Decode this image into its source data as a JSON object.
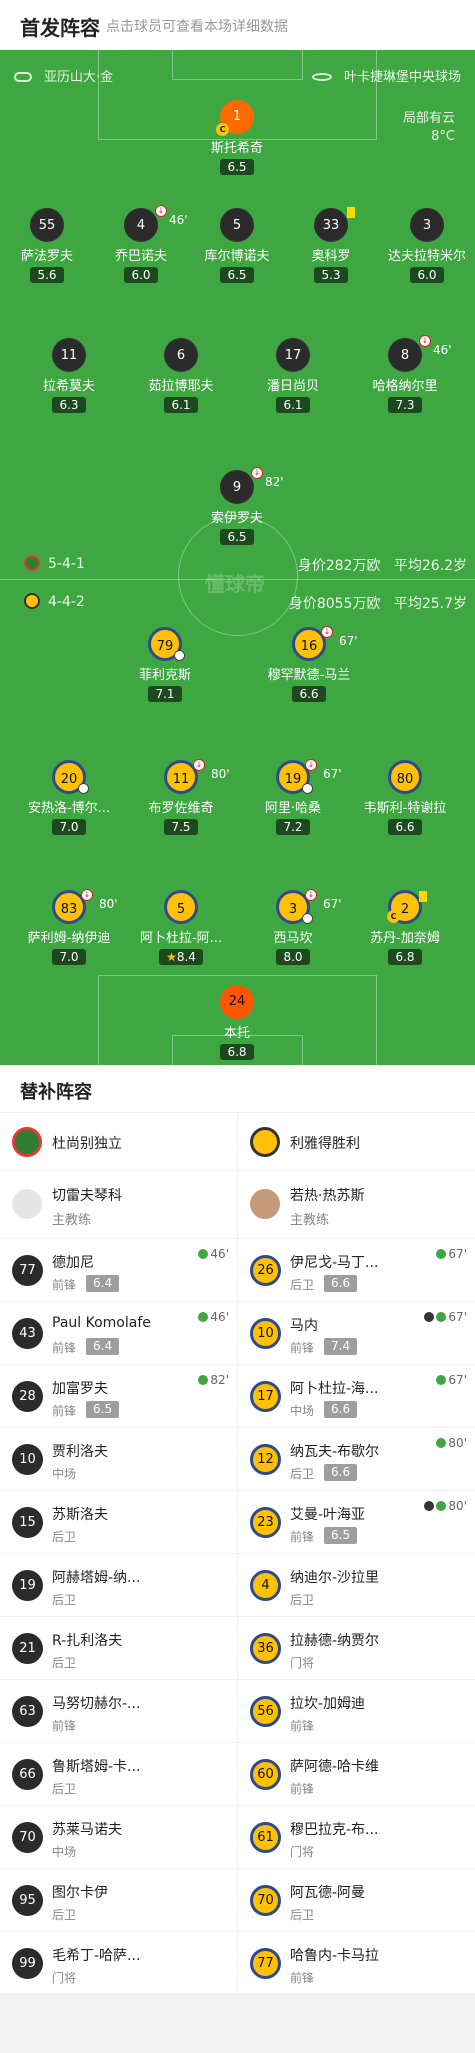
{
  "header": {
    "title": "首发阵容",
    "subtitle": "点击球员可查看本场详细数据"
  },
  "pitch": {
    "home_venue": "亚历山大·金",
    "away_venue": "叶卡捷琳堡中央球场",
    "weather": "局部有云",
    "temperature": "8°C",
    "home_formation": "5-4-1",
    "away_formation": "4-4-2",
    "home_value": "身价282万欧",
    "home_age": "平均26.2岁",
    "away_value": "身价8055万欧",
    "away_age": "平均25.7岁",
    "watermark": "懂球帝"
  },
  "home_lineup": [
    {
      "num": "1",
      "name": "斯托希奇",
      "rating": "6.5"
    },
    {
      "num": "55",
      "name": "萨法罗夫",
      "rating": "5.6"
    },
    {
      "num": "4",
      "name": "乔巴诺夫",
      "rating": "6.0",
      "sub": "46'"
    },
    {
      "num": "5",
      "name": "库尔博诺夫",
      "rating": "6.5"
    },
    {
      "num": "33",
      "name": "奥科罗",
      "rating": "5.3"
    },
    {
      "num": "3",
      "name": "达夫拉特米尔",
      "rating": "6.0"
    },
    {
      "num": "11",
      "name": "拉希莫夫",
      "rating": "6.3"
    },
    {
      "num": "6",
      "name": "茹拉博耶夫",
      "rating": "6.1"
    },
    {
      "num": "17",
      "name": "潘日尚贝",
      "rating": "6.1"
    },
    {
      "num": "8",
      "name": "哈格纳尔里",
      "rating": "7.3",
      "sub": "46'"
    },
    {
      "num": "9",
      "name": "索伊罗夫",
      "rating": "6.5",
      "sub": "82'"
    }
  ],
  "away_lineup": [
    {
      "num": "79",
      "name": "菲利克斯",
      "rating": "7.1"
    },
    {
      "num": "16",
      "name": "穆罕默德-马兰",
      "rating": "6.6",
      "sub": "67'"
    },
    {
      "num": "20",
      "name": "安热洛-博尔...",
      "rating": "7.0"
    },
    {
      "num": "11",
      "name": "布罗佐维奇",
      "rating": "7.5",
      "sub": "80'"
    },
    {
      "num": "19",
      "name": "阿里·哈桑",
      "rating": "7.2",
      "sub": "67'"
    },
    {
      "num": "80",
      "name": "韦斯利-特谢拉",
      "rating": "6.6"
    },
    {
      "num": "83",
      "name": "萨利姆-纳伊迪",
      "rating": "7.0",
      "sub": "80'"
    },
    {
      "num": "5",
      "name": "阿卜杜拉-阿...",
      "rating": "8.4"
    },
    {
      "num": "3",
      "name": "西马坎",
      "rating": "8.0",
      "sub": "67'"
    },
    {
      "num": "2",
      "name": "苏丹-加奈姆",
      "rating": "6.8"
    },
    {
      "num": "24",
      "name": "本托",
      "rating": "6.8"
    }
  ],
  "subs": {
    "title": "替补阵容",
    "home_team": "杜尚别独立",
    "away_team": "利雅得胜利",
    "home_coach": "切雷夫琴科",
    "away_coach": "若热·热苏斯",
    "coach_role": "主教练",
    "home": [
      {
        "num": "77",
        "name": "德加尼",
        "pos": "前锋",
        "rating": "6.4",
        "min": "46'"
      },
      {
        "num": "43",
        "name": "Paul Komolafe",
        "pos": "前锋",
        "rating": "6.4",
        "min": "46'"
      },
      {
        "num": "28",
        "name": "加富罗夫",
        "pos": "前锋",
        "rating": "6.5",
        "min": "82'"
      },
      {
        "num": "10",
        "name": "贾利洛夫",
        "pos": "中场"
      },
      {
        "num": "15",
        "name": "苏斯洛夫",
        "pos": "后卫"
      },
      {
        "num": "19",
        "name": "阿赫塔姆-纳...",
        "pos": "后卫"
      },
      {
        "num": "21",
        "name": "R-扎利洛夫",
        "pos": "后卫"
      },
      {
        "num": "63",
        "name": "马努切赫尔-...",
        "pos": "前锋"
      },
      {
        "num": "66",
        "name": "鲁斯塔姆-卡...",
        "pos": "后卫"
      },
      {
        "num": "70",
        "name": "苏莱马诺夫",
        "pos": "中场"
      },
      {
        "num": "95",
        "name": "图尔卡伊",
        "pos": "后卫"
      },
      {
        "num": "99",
        "name": "毛希丁-哈萨...",
        "pos": "门将"
      }
    ],
    "away": [
      {
        "num": "26",
        "name": "伊尼戈-马丁...",
        "pos": "后卫",
        "rating": "6.6",
        "min": "67'"
      },
      {
        "num": "10",
        "name": "马内",
        "pos": "前锋",
        "rating": "7.4",
        "min": "67'",
        "goal": true
      },
      {
        "num": "17",
        "name": "阿卜杜拉-海...",
        "pos": "中场",
        "rating": "6.6",
        "min": "67'"
      },
      {
        "num": "12",
        "name": "纳瓦夫-布歇尔",
        "pos": "后卫",
        "rating": "6.6",
        "min": "80'"
      },
      {
        "num": "23",
        "name": "艾曼-叶海亚",
        "pos": "前锋",
        "rating": "6.5",
        "min": "80'",
        "goal": true
      },
      {
        "num": "4",
        "name": "纳迪尔-沙拉里",
        "pos": "后卫"
      },
      {
        "num": "36",
        "name": "拉赫德-纳贾尔",
        "pos": "门将"
      },
      {
        "num": "56",
        "name": "拉坎-加姆迪",
        "pos": "前锋"
      },
      {
        "num": "60",
        "name": "萨阿德-哈卡维",
        "pos": "前锋"
      },
      {
        "num": "61",
        "name": "穆巴拉克-布...",
        "pos": "门将"
      },
      {
        "num": "70",
        "name": "阿瓦德-阿曼",
        "pos": "后卫"
      },
      {
        "num": "77",
        "name": "哈鲁内-卡马拉",
        "pos": "前锋"
      }
    ]
  },
  "colors": {
    "pitch": "#3fa742",
    "home_kit": "#2b2b2b",
    "away_kit": "#ffc107",
    "away_border": "#2f4a8a"
  }
}
